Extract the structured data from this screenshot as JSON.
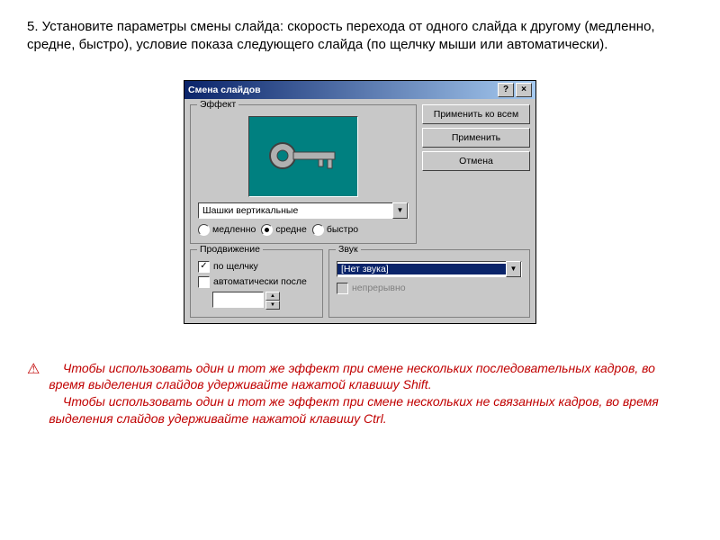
{
  "instruction": "5.  Установите параметры смены слайда: скорость перехода от одного слайда к другому (медленно, средне, быстро), условие показа следующего слайда (по щелчку мыши или автоматически).",
  "dialog": {
    "title": "Смена слайдов",
    "effect_group": "Эффект",
    "effect_value": "Шашки вертикальные",
    "speed_slow": "медленно",
    "speed_medium": "средне",
    "speed_fast": "быстро",
    "advance_group": "Продвижение",
    "advance_click": "по щелчку",
    "advance_auto": "автоматически после",
    "sound_group": "Звук",
    "sound_value": "[Нет звука]",
    "sound_loop": "непрерывно",
    "btn_apply_all": "Применить ко всем",
    "btn_apply": "Применить",
    "btn_cancel": "Отмена"
  },
  "note": {
    "line1": "Чтобы использовать один и тот же эффект при смене нескольких последовательных кадров, во время выделения слайдов удерживайте нажатой клавишу Shift.",
    "line2": "Чтобы использовать один и тот же эффект при смене нескольких не связанных кадров, во время выделения слайдов удерживайте нажатой клавишу Ctrl."
  }
}
